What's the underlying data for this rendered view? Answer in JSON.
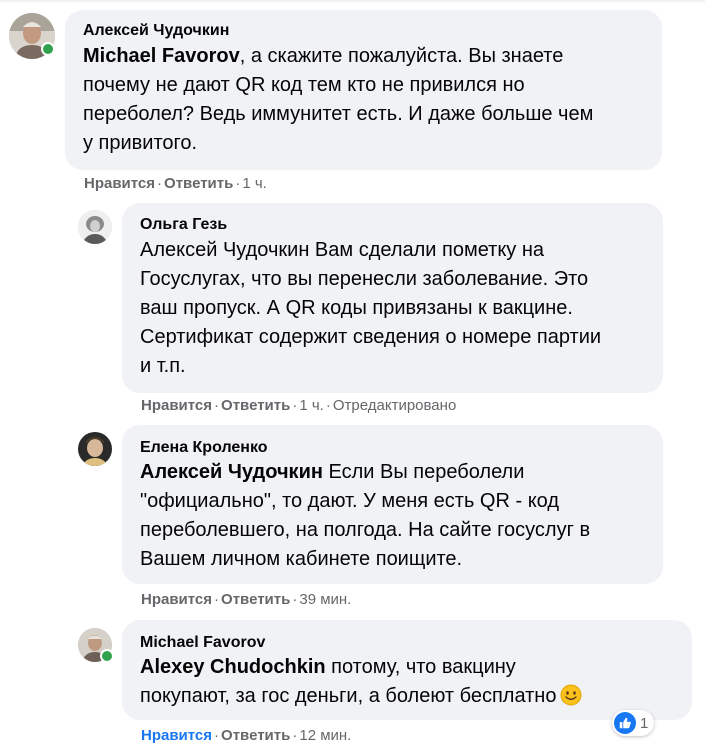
{
  "comments": [
    {
      "author": "Алексей Чудочкин",
      "mention": "Michael Favorov",
      "lines": [
        ", а скажите пожалуйста. Вы знаете",
        "почему не дают QR код тем кто не привился но",
        "переболел? Ведь иммунитет есть. И даже больше чем",
        "у привитого."
      ],
      "like_label": "Нравится",
      "reply_label": "Ответить",
      "time": "1 ч.",
      "online": true
    },
    {
      "author": "Ольга Гезь",
      "mention": "",
      "lines": [
        "Алексей Чудочкин Вам сделали пометку на",
        "Госуслугах, что вы перенесли заболевание. Это",
        "ваш пропуск. А QR коды привязаны к вакцине.",
        "Сертификат содержит сведения о номере партии",
        "и т.п."
      ],
      "like_label": "Нравится",
      "reply_label": "Ответить",
      "time": "1 ч.",
      "edited": "Отредактировано"
    },
    {
      "author": "Елена Кроленко",
      "mention": "Алексей Чудочкин",
      "lines": [
        " Если Вы переболели",
        "\"официально\", то дают. У меня есть QR - код",
        "переболевшего, на полгода. На сайте госуслуг в",
        "Вашем личном кабинете поищите."
      ],
      "like_label": "Нравится",
      "reply_label": "Ответить",
      "time": "39 мин."
    },
    {
      "author": "Michael Favorov",
      "mention": "Alexey Chudochkin",
      "lines": [
        " потому, что вакцину",
        "покупают, за гос деньги, а болеют бесплатно"
      ],
      "emoji": "slightly-smiling-face",
      "like_label": "Нравится",
      "reply_label": "Ответить",
      "time": "12 мин.",
      "online": true,
      "reaction_count": "1"
    }
  ],
  "colors": {
    "bubble": "#f0f2f5",
    "action": "#65676b",
    "liked": "#1877f2",
    "online": "#31a24c"
  },
  "icons": {
    "reaction": "like-thumbs-up-icon",
    "emoji": "smiling-face-emoji-icon"
  }
}
